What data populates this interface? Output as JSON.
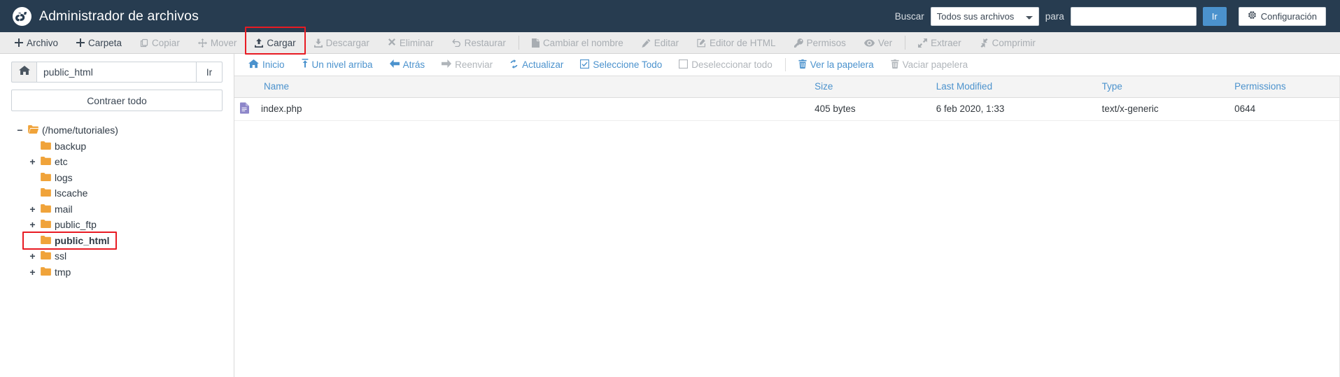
{
  "header": {
    "title": "Administrador de archivos",
    "logo_icon": "cpanel-logo-icon",
    "search_label": "Buscar",
    "scope_selected": "Todos sus archivos",
    "scope_options": [
      "Todos sus archivos"
    ],
    "for_label": "para",
    "search_value": "",
    "search_placeholder": "",
    "go_label": "Ir",
    "settings_label": "Configuración",
    "settings_icon": "gear-icon",
    "bg_color": "#273c50"
  },
  "toolbar": {
    "items": [
      {
        "label": "Archivo",
        "icon": "plus-icon",
        "disabled": false
      },
      {
        "label": "Carpeta",
        "icon": "plus-icon",
        "disabled": false
      },
      {
        "label": "Copiar",
        "icon": "copy-icon",
        "disabled": true
      },
      {
        "label": "Mover",
        "icon": "move-icon",
        "disabled": true
      },
      {
        "label": "Cargar",
        "icon": "upload-icon",
        "disabled": false,
        "highlighted": true
      },
      {
        "label": "Descargar",
        "icon": "download-icon",
        "disabled": true
      },
      {
        "label": "Eliminar",
        "icon": "x-icon",
        "disabled": true
      },
      {
        "label": "Restaurar",
        "icon": "undo-icon",
        "disabled": true
      },
      {
        "label": "Cambiar el nombre",
        "icon": "file-icon",
        "disabled": true,
        "sep_before": true
      },
      {
        "label": "Editar",
        "icon": "pencil-icon",
        "disabled": true
      },
      {
        "label": "Editor de HTML",
        "icon": "html-editor-icon",
        "disabled": true
      },
      {
        "label": "Permisos",
        "icon": "key-icon",
        "disabled": true
      },
      {
        "label": "Ver",
        "icon": "eye-icon",
        "disabled": true
      },
      {
        "label": "Extraer",
        "icon": "expand-icon",
        "disabled": true,
        "sep_before": true
      },
      {
        "label": "Comprimir",
        "icon": "compress-icon",
        "disabled": true
      }
    ],
    "highlight_color": "#e81b23"
  },
  "sidebar": {
    "home_icon": "home-icon",
    "path_value": "public_html",
    "go_label": "Ir",
    "collapse_label": "Contraer todo",
    "tree": [
      {
        "label": "(/home/tutoriales)",
        "toggle": "−",
        "depth": 0,
        "icon": "folder-open-home-icon",
        "bold": false
      },
      {
        "label": "backup",
        "toggle": "",
        "depth": 1,
        "icon": "folder-icon",
        "bold": false
      },
      {
        "label": "etc",
        "toggle": "+",
        "depth": 1,
        "icon": "folder-icon",
        "bold": false
      },
      {
        "label": "logs",
        "toggle": "",
        "depth": 1,
        "icon": "folder-icon",
        "bold": false
      },
      {
        "label": "lscache",
        "toggle": "",
        "depth": 1,
        "icon": "folder-icon",
        "bold": false
      },
      {
        "label": "mail",
        "toggle": "+",
        "depth": 1,
        "icon": "folder-icon",
        "bold": false
      },
      {
        "label": "public_ftp",
        "toggle": "+",
        "depth": 1,
        "icon": "folder-icon",
        "bold": false
      },
      {
        "label": "public_html",
        "toggle": "",
        "depth": 1,
        "icon": "folder-icon",
        "bold": true,
        "highlighted": true
      },
      {
        "label": "ssl",
        "toggle": "+",
        "depth": 1,
        "icon": "folder-icon",
        "bold": false
      },
      {
        "label": "tmp",
        "toggle": "+",
        "depth": 1,
        "icon": "folder-icon",
        "bold": false
      }
    ]
  },
  "navbar": {
    "items": [
      {
        "label": "Inicio",
        "icon": "home-icon",
        "disabled": false
      },
      {
        "label": "Un nivel arriba",
        "icon": "up-arrow-icon",
        "disabled": false
      },
      {
        "label": "Atrás",
        "icon": "back-arrow-icon",
        "disabled": false
      },
      {
        "label": "Reenviar",
        "icon": "forward-arrow-icon",
        "disabled": true
      },
      {
        "label": "Actualizar",
        "icon": "refresh-icon",
        "disabled": false
      },
      {
        "label": "Seleccione Todo",
        "icon": "checkbox-checked-icon",
        "disabled": false
      },
      {
        "label": "Deseleccionar todo",
        "icon": "checkbox-empty-icon",
        "disabled": true
      },
      {
        "label": "Ver la papelera",
        "icon": "trash-icon",
        "disabled": false,
        "sep_before": true
      },
      {
        "label": "Vaciar papelera",
        "icon": "trash-icon",
        "disabled": true
      }
    ],
    "link_color": "#4b92cd"
  },
  "files": {
    "columns": [
      "Name",
      "Size",
      "Last Modified",
      "Type",
      "Permissions"
    ],
    "rows": [
      {
        "icon": "php-file-icon",
        "name": "index.php",
        "size": "405 bytes",
        "modified": "6 feb 2020, 1:33",
        "type": "text/x-generic",
        "permissions": "0644"
      }
    ]
  }
}
